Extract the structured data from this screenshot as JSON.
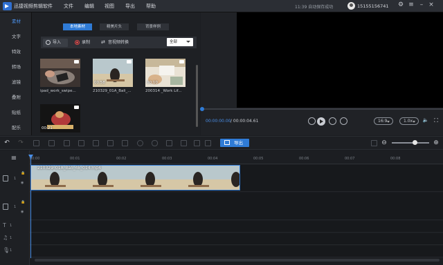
{
  "app": {
    "title": "迅捷视频剪辑软件",
    "autosave": "11:39 自动保存成功",
    "user": "15155156741"
  },
  "menu": [
    "文件",
    "编辑",
    "视图",
    "导出",
    "帮助"
  ],
  "nav": [
    "素材",
    "文字",
    "特效",
    "转场",
    "滤镜",
    "叠附",
    "贴纸",
    "配乐"
  ],
  "media": {
    "tabs": [
      "本地素材",
      "精美片头",
      "背景样例"
    ],
    "toolbar": {
      "import": "导入",
      "record": "录制",
      "convert": "音视频转换",
      "filter": "全部"
    },
    "clips": [
      {
        "name": "ipad_work_swipe...",
        "duration": ""
      },
      {
        "name": "210329_01A_Bali_...",
        "duration": "00:58"
      },
      {
        "name": "200314 _Work Lif...",
        "duration": "00:10"
      },
      {
        "name": "",
        "duration": "00:21"
      }
    ]
  },
  "preview": {
    "current_time": "00:00:00.00",
    "total_time": "/ 00:00:04.61",
    "aspect": "16:9",
    "speed": "1.0x"
  },
  "timeline": {
    "export_label": "导出",
    "ruler": [
      "00:00",
      "00:01",
      "00:02",
      "00:03",
      "00:04",
      "00:05",
      "00:06",
      "00:07",
      "00:08"
    ],
    "clip_label": "210329_01A_Bali_4k_014.mp4",
    "track_numbers": [
      "1",
      "1",
      "1",
      "1",
      "1"
    ]
  },
  "colors": {
    "accent": "#2f7bd6",
    "background": "#1b1d21"
  }
}
